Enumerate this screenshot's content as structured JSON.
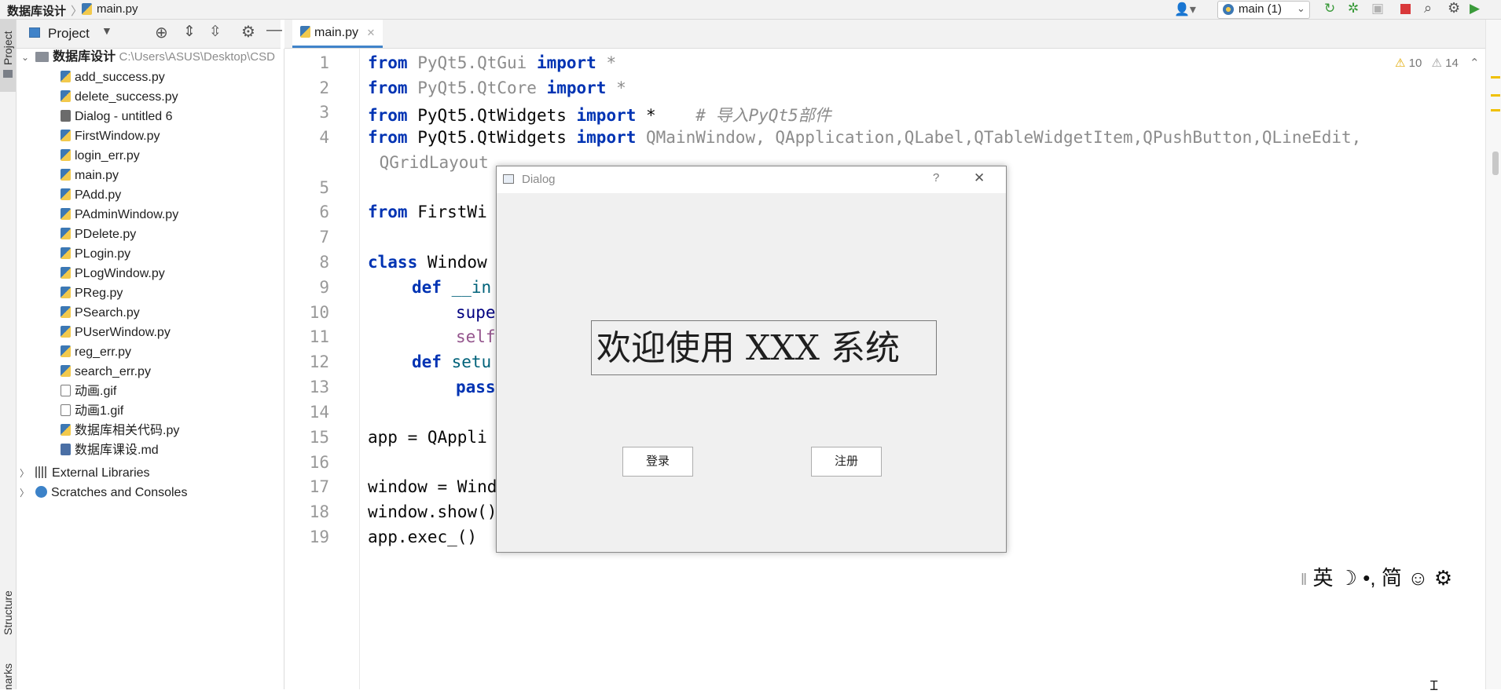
{
  "breadcrumb": {
    "project": "数据库设计",
    "file": "main.py"
  },
  "toolbar": {
    "run_config": "main (1)"
  },
  "left_stripe": {
    "project_label": "Project",
    "structure_label": "Structure",
    "bookmarks_label": "Bookmarks"
  },
  "project_panel": {
    "title": "Project",
    "root": {
      "name": "数据库设计",
      "path": "C:\\Users\\ASUS\\Desktop\\CSD"
    },
    "files": [
      {
        "name": "add_success.py",
        "icon": "python-file-icon"
      },
      {
        "name": "delete_success.py",
        "icon": "python-file-icon"
      },
      {
        "name": "Dialog - untitled 6",
        "icon": "ui-file-icon"
      },
      {
        "name": "FirstWindow.py",
        "icon": "python-file-icon"
      },
      {
        "name": "login_err.py",
        "icon": "python-file-icon"
      },
      {
        "name": "main.py",
        "icon": "python-file-icon"
      },
      {
        "name": "PAdd.py",
        "icon": "python-file-icon"
      },
      {
        "name": "PAdminWindow.py",
        "icon": "python-file-icon"
      },
      {
        "name": "PDelete.py",
        "icon": "python-file-icon"
      },
      {
        "name": "PLogin.py",
        "icon": "python-file-icon"
      },
      {
        "name": "PLogWindow.py",
        "icon": "python-file-icon"
      },
      {
        "name": "PReg.py",
        "icon": "python-file-icon"
      },
      {
        "name": "PSearch.py",
        "icon": "python-file-icon"
      },
      {
        "name": "PUserWindow.py",
        "icon": "python-file-icon"
      },
      {
        "name": "reg_err.py",
        "icon": "python-file-icon"
      },
      {
        "name": "search_err.py",
        "icon": "python-file-icon"
      },
      {
        "name": "动画.gif",
        "icon": "gif-file-icon"
      },
      {
        "name": "动画1.gif",
        "icon": "gif-file-icon"
      },
      {
        "name": "数据库相关代码.py",
        "icon": "python-file-icon"
      },
      {
        "name": "数据库课设.md",
        "icon": "markdown-file-icon"
      }
    ],
    "external_libraries": "External Libraries",
    "scratches": "Scratches and Consoles"
  },
  "editor": {
    "tab_label": "main.py",
    "warnings": "10",
    "weak_warnings": "14",
    "line_numbers": [
      "1",
      "2",
      "3",
      "4",
      "5",
      "6",
      "7",
      "8",
      "9",
      "10",
      "11",
      "12",
      "13",
      "14",
      "15",
      "16",
      "17",
      "18",
      "19"
    ],
    "lines": {
      "l1": {
        "kw1": "from",
        "mod": " PyQt5.QtGui ",
        "kw2": "import",
        "rest": " *"
      },
      "l2": {
        "kw1": "from",
        "mod": " PyQt5.QtCore ",
        "kw2": "import",
        "rest": " *"
      },
      "l3": {
        "kw1": "from",
        "mod": " PyQt5.QtWidgets ",
        "kw2": "import",
        "rest": " *    ",
        "comment": "# 导入PyQt5部件"
      },
      "l4": {
        "kw1": "from",
        "mod": " PyQt5.QtWidgets ",
        "kw2": "import",
        "rest": " QMainWindow, QApplication,QLabel,QTableWidgetItem,QPushButton,QLineEdit,"
      },
      "l4b": " QGridLayout",
      "l6": {
        "kw1": "from",
        "rest": " FirstWi"
      },
      "l8": {
        "kw1": "class",
        "rest": " Window"
      },
      "l9": {
        "kw1": "def",
        "rest": " __in"
      },
      "l10": "supe",
      "l11": "self",
      "l12": {
        "kw1": "def",
        "rest": " setu"
      },
      "l13": "pass",
      "l15": "app = QAppli",
      "l17": "window = Window()",
      "l18": "window.show()",
      "l19": "app.exec_()"
    }
  },
  "dialog": {
    "title": "Dialog",
    "help": "?",
    "close": "✕",
    "welcome_text": "欢迎使用 XXX 系统",
    "login_button": "登录",
    "register_button": "注册"
  },
  "ime_bar": {
    "mode": "英",
    "moon": "☽",
    "punct": "•,",
    "simplified": "简",
    "emoji": "☺",
    "settings": "⚙"
  }
}
